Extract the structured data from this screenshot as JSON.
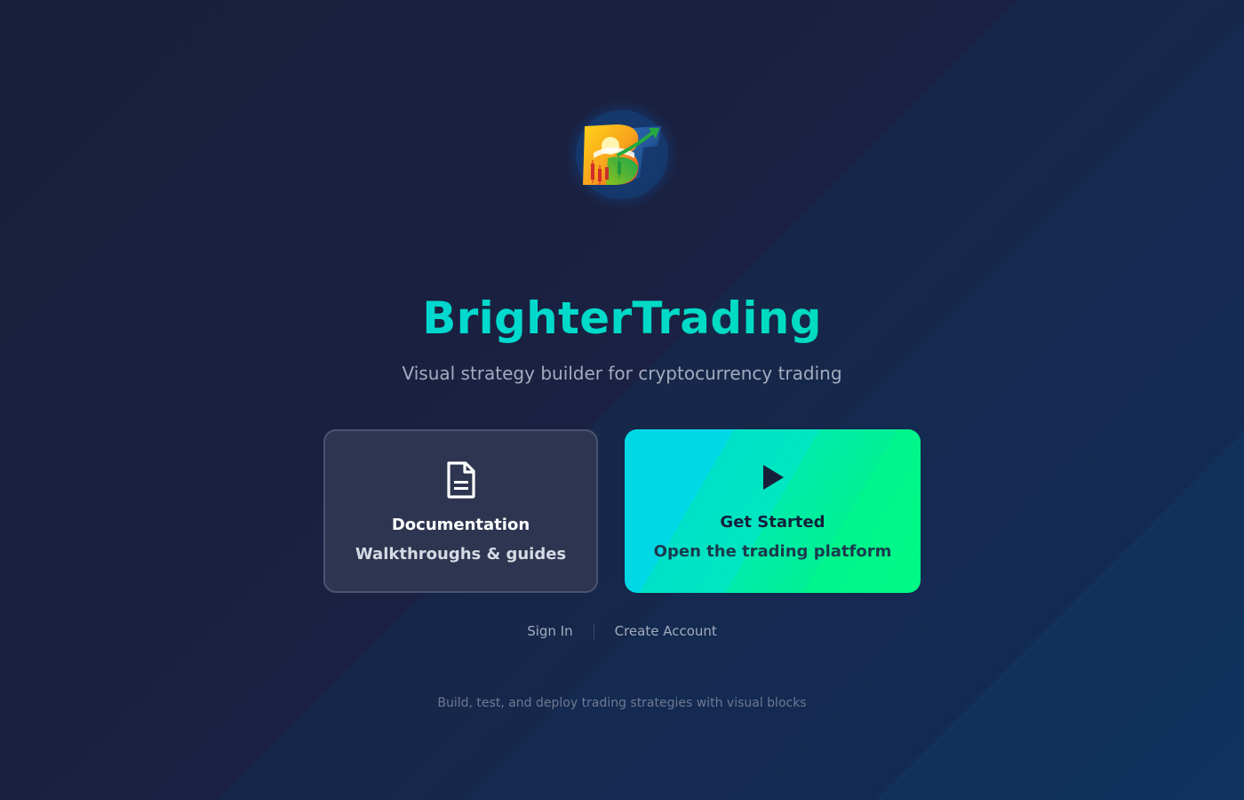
{
  "brand": {
    "name": "BrighterTrading",
    "tagline": "Visual strategy builder for cryptocurrency trading",
    "logo_icon": "brighter-trading-logo"
  },
  "cards": {
    "docs": {
      "icon": "document-icon",
      "title": "Documentation",
      "subtitle": "Walkthroughs & guides"
    },
    "start": {
      "icon": "play-icon",
      "title": "Get Started",
      "subtitle": "Open the trading platform"
    }
  },
  "auth": {
    "sign_in": "Sign In",
    "create_account": "Create Account"
  },
  "footer": {
    "text": "Build, test, and deploy trading strategies with visual blocks"
  },
  "colors": {
    "accent_start": "#00d4e0",
    "accent_end": "#00fa85",
    "background": "#181f3a"
  }
}
